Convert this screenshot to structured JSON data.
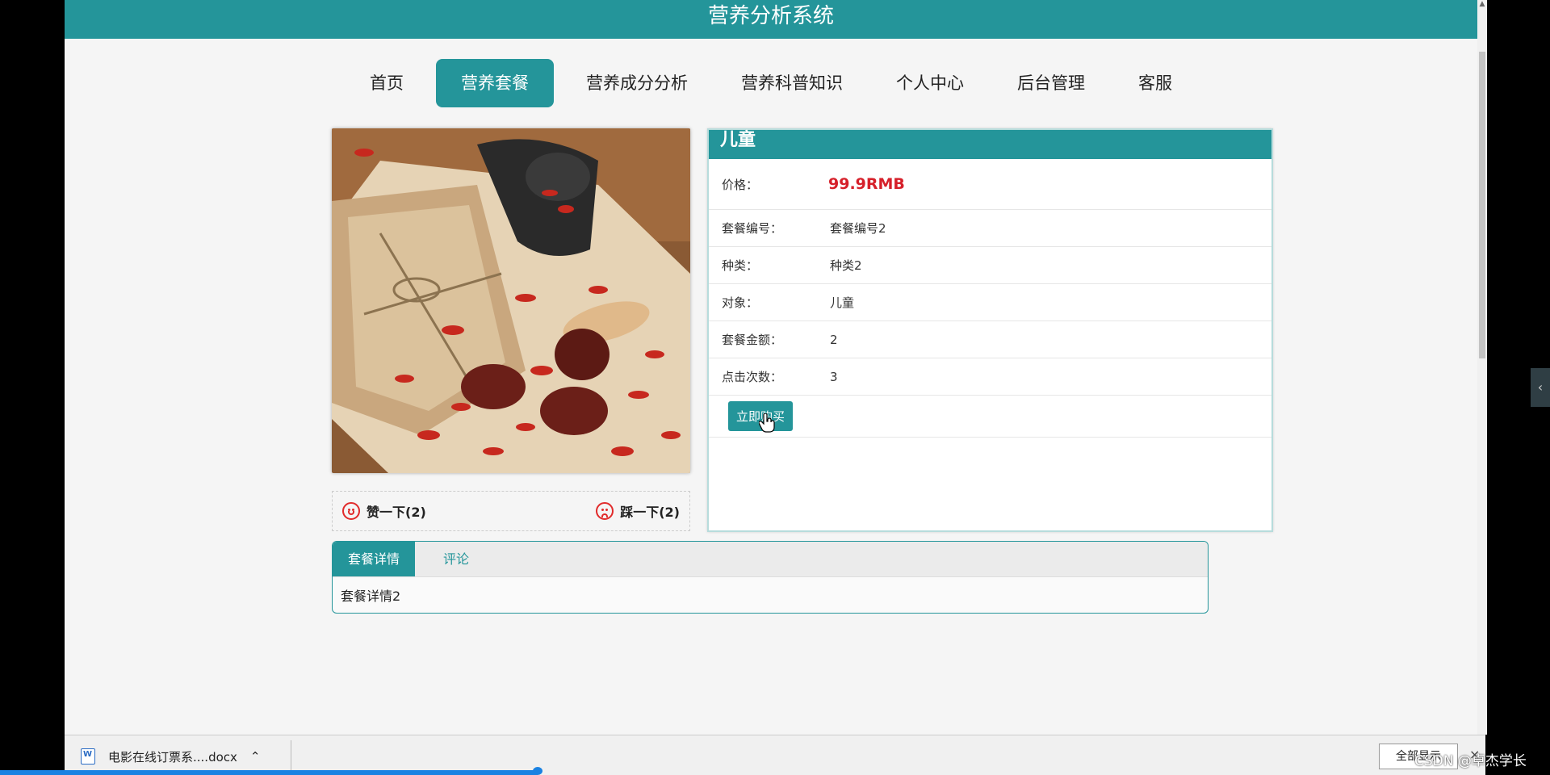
{
  "header": {
    "title": "营养分析系统"
  },
  "nav": {
    "items": [
      {
        "label": "首页",
        "active": false
      },
      {
        "label": "营养套餐",
        "active": true
      },
      {
        "label": "营养成分分析",
        "active": false
      },
      {
        "label": "营养科普知识",
        "active": false
      },
      {
        "label": "个人中心",
        "active": false
      },
      {
        "label": "后台管理",
        "active": false
      },
      {
        "label": "客服",
        "active": false
      }
    ]
  },
  "product": {
    "title": "儿童",
    "price_label": "价格：",
    "price_value": "99.9RMB",
    "fields": [
      {
        "label": "套餐编号：",
        "value": "套餐编号2"
      },
      {
        "label": "种类：",
        "value": "种类2"
      },
      {
        "label": "对象：",
        "value": "儿童"
      },
      {
        "label": "套餐金额：",
        "value": "2"
      },
      {
        "label": "点击次数：",
        "value": "3"
      }
    ],
    "buy_label": "立即购买"
  },
  "votes": {
    "like_label": "赞一下(2)",
    "dislike_label": "踩一下(2)"
  },
  "tabs": {
    "items": [
      {
        "label": "套餐详情",
        "active": true
      },
      {
        "label": "评论",
        "active": false
      }
    ],
    "content": "套餐详情2"
  },
  "downloads": {
    "file_name": "电影在线订票系....docx",
    "show_all_label": "全部显示",
    "close_label": "×"
  },
  "watermark": "CSDN @卓杰学长",
  "colors": {
    "accent": "#24959a",
    "price": "#d6202a",
    "progress": "#1a82e2"
  }
}
